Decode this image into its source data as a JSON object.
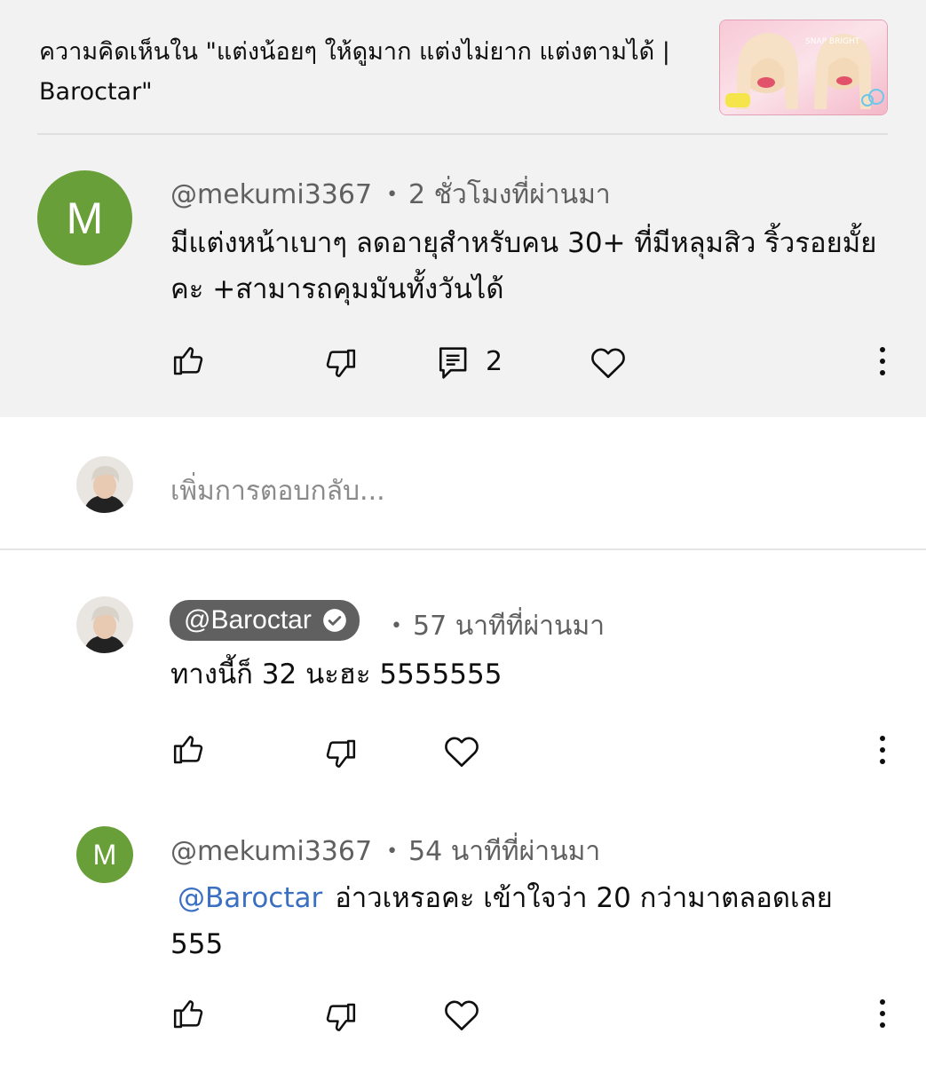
{
  "header": {
    "title": "ความคิดเห็นใน \"แต่งน้อยๆ ให้ดูมาก แต่งไม่ยาก แต่งตามได้ | Baroctar\"",
    "thumbnail_text": "SNAP BRIGHT"
  },
  "main_comment": {
    "avatar_letter": "M",
    "author": "@mekumi3367",
    "time": "2 ชั่วโมงที่ผ่านมา",
    "text": "มีแต่งหน้าเบาๆ ลดอายุสำหรับคน 30+ ที่มีหลุมสิว ริ้วรอยมั้ยคะ +สามารถคุมมันทั้งวันได้",
    "reply_count": "2"
  },
  "reply_box": {
    "placeholder": "เพิ่มการตอบกลับ..."
  },
  "replies": [
    {
      "author": "@Baroctar",
      "verified": true,
      "time": "57 นาทีที่ผ่านมา",
      "text": "ทางนี้ก็ 32 นะฮะ 5555555"
    },
    {
      "avatar_letter": "M",
      "author": "@mekumi3367",
      "time": "54 นาทีที่ผ่านมา",
      "mention": "@Baroctar",
      "text": "อ่าวเหรอคะ เข้าใจว่า 20 กว่ามาตลอดเลย 555"
    }
  ],
  "colors": {
    "avatar_green": "#689f38",
    "mention_blue": "#3b6fc2",
    "header_bg": "#f2f2f2"
  },
  "icons": [
    "thumbs-up-icon",
    "thumbs-down-icon",
    "comment-icon",
    "heart-icon",
    "more-vert-icon",
    "verified-check-icon"
  ]
}
